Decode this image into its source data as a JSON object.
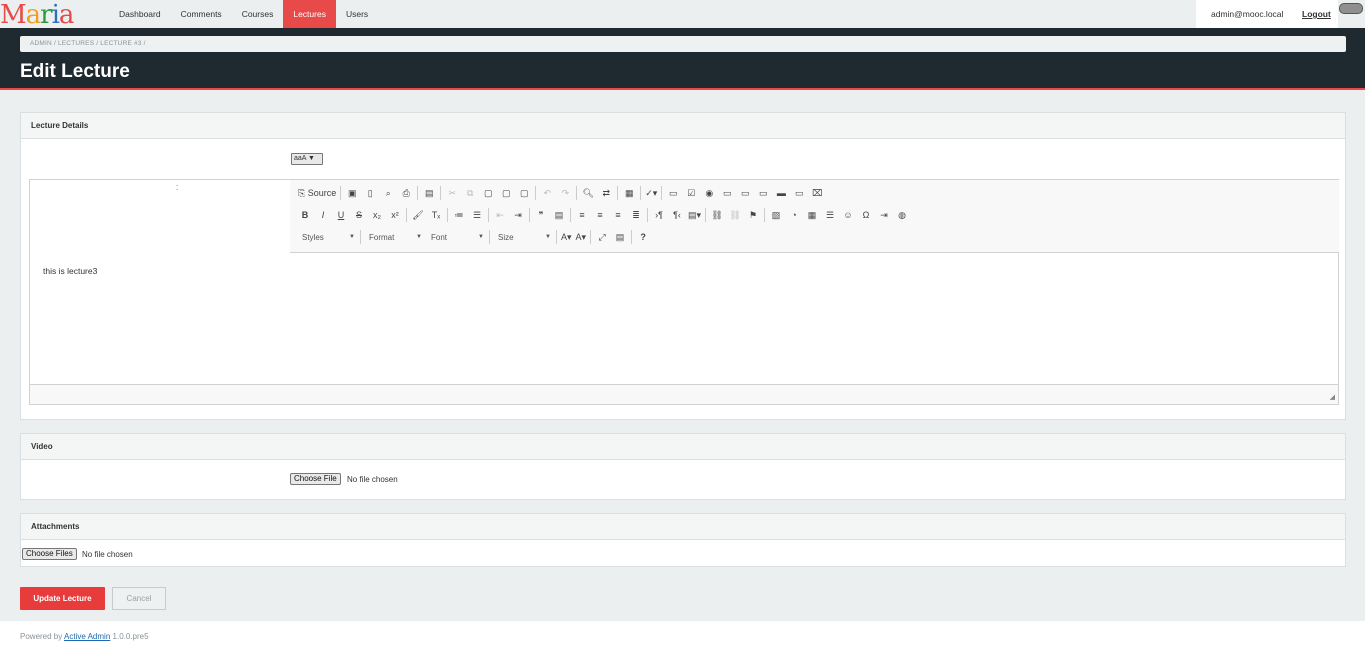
{
  "app": {
    "logo": "Maria",
    "logo_colors": [
      "#e84a4a",
      "#f0a020",
      "#2a9a3a",
      "#2a70c0",
      "#e84a4a"
    ]
  },
  "nav": {
    "items": [
      {
        "label": "Dashboard",
        "active": false
      },
      {
        "label": "Comments",
        "active": false
      },
      {
        "label": "Courses",
        "active": false
      },
      {
        "label": "Lectures",
        "active": true
      },
      {
        "label": "Users",
        "active": false
      }
    ],
    "user_email": "admin@mooc.local",
    "logout_label": "Logout"
  },
  "breadcrumb": "ADMIN / LECTURES / LECTURE #3 /",
  "page_title": "Edit Lecture",
  "lecture_details": {
    "heading": "Lecture Details",
    "font_button": "aaA ▼",
    "editor": {
      "source_label": "Source",
      "combos": [
        "Styles",
        "Format",
        "Font",
        "Size"
      ],
      "content": "this is lecture3"
    }
  },
  "video": {
    "heading": "Video",
    "choose_label": "Choose File",
    "status": "No file chosen"
  },
  "attachments": {
    "heading": "Attachments",
    "choose_label": "Choose Files",
    "status": "No file chosen"
  },
  "actions": {
    "update_label": "Update Lecture",
    "cancel_label": "Cancel"
  },
  "footer": {
    "prefix": "Powered by",
    "link": "Active Admin",
    "version": "1.0.0.pre5"
  },
  "colors": {
    "accent": "#e84a4a",
    "header_bg": "#1f2a30"
  }
}
